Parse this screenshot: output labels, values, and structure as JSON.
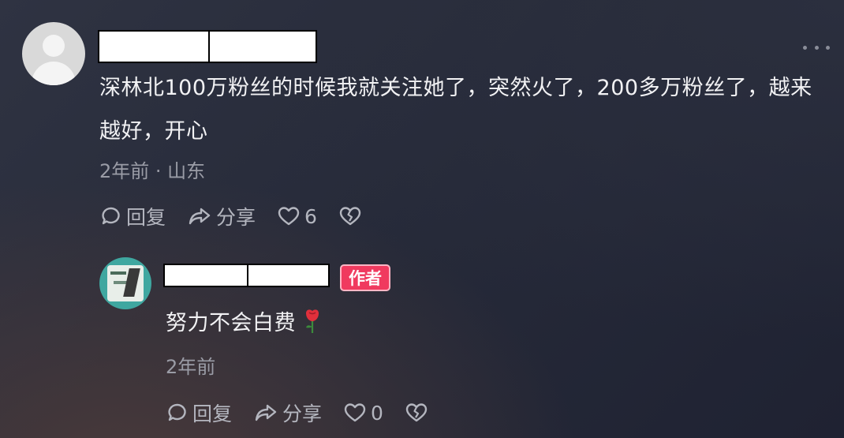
{
  "comment": {
    "username_redacted": "",
    "text": "深林北100万粉丝的时候我就关注她了，突然火了，200多万粉丝了，越来越好，开心",
    "meta": "2年前 · 山东",
    "actions": {
      "reply": "回复",
      "share": "分享",
      "likes": "6"
    }
  },
  "reply": {
    "username_redacted": "",
    "author_badge": "作者",
    "text": "努力不会白费",
    "emoji_icon": "rose-icon",
    "meta": "2年前",
    "actions": {
      "reply": "回复",
      "share": "分享",
      "likes": "0"
    }
  },
  "colors": {
    "author_badge": "#f03a5f",
    "action_text": "#b4b6bf",
    "meta_text": "#9a9ca6"
  }
}
